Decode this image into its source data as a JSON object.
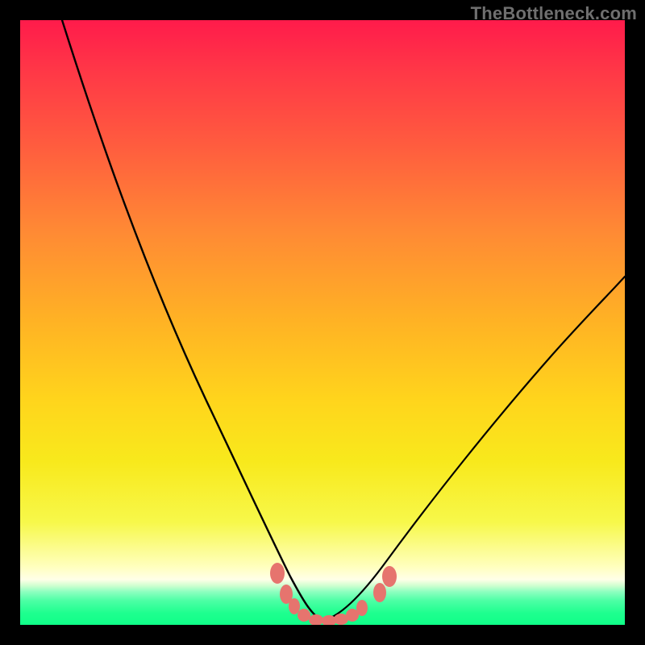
{
  "watermark": "TheBottleneck.com",
  "chart_data": {
    "type": "line",
    "title": "",
    "xlabel": "",
    "ylabel": "",
    "xlim": [
      0,
      100
    ],
    "ylim": [
      0,
      100
    ],
    "series": [
      {
        "name": "left-curve",
        "x": [
          7,
          10,
          14,
          18,
          22,
          26,
          30,
          34,
          38,
          41,
          44,
          46,
          48,
          50
        ],
        "y": [
          100,
          92,
          81,
          70,
          59,
          48,
          38,
          28,
          18,
          11,
          6,
          3,
          1.2,
          0.6
        ]
      },
      {
        "name": "right-curve",
        "x": [
          50,
          54,
          58,
          63,
          68,
          74,
          80,
          86,
          92,
          100
        ],
        "y": [
          0.6,
          1.4,
          3.0,
          6.5,
          11.5,
          18.5,
          27,
          36,
          45,
          58
        ]
      }
    ],
    "markers": {
      "name": "threshold-markers",
      "color": "#e6746e",
      "points": [
        {
          "x": 42.5,
          "y": 8.5
        },
        {
          "x": 44.0,
          "y": 5.0
        },
        {
          "x": 45.3,
          "y": 3.0
        },
        {
          "x": 47.0,
          "y": 1.5
        },
        {
          "x": 49.0,
          "y": 0.8
        },
        {
          "x": 51.0,
          "y": 0.7
        },
        {
          "x": 53.0,
          "y": 0.9
        },
        {
          "x": 55.0,
          "y": 1.6
        },
        {
          "x": 56.5,
          "y": 2.8
        },
        {
          "x": 59.5,
          "y": 5.3
        },
        {
          "x": 61.0,
          "y": 8.0
        }
      ]
    },
    "gradient_stops": [
      {
        "pos": 0,
        "color": "#ff1b4b"
      },
      {
        "pos": 8,
        "color": "#ff3647"
      },
      {
        "pos": 20,
        "color": "#ff5a3f"
      },
      {
        "pos": 35,
        "color": "#ff8a34"
      },
      {
        "pos": 50,
        "color": "#ffb324"
      },
      {
        "pos": 63,
        "color": "#ffd51c"
      },
      {
        "pos": 73,
        "color": "#f8e91c"
      },
      {
        "pos": 83,
        "color": "#f7f84a"
      },
      {
        "pos": 90.5,
        "color": "#ffffc0"
      },
      {
        "pos": 92.5,
        "color": "#ffffe8"
      },
      {
        "pos": 93.5,
        "color": "#d0ffd0"
      },
      {
        "pos": 94.5,
        "color": "#8fffc0"
      },
      {
        "pos": 96,
        "color": "#4cffa5"
      },
      {
        "pos": 98,
        "color": "#1fff8f"
      },
      {
        "pos": 100,
        "color": "#10ff88"
      }
    ]
  }
}
